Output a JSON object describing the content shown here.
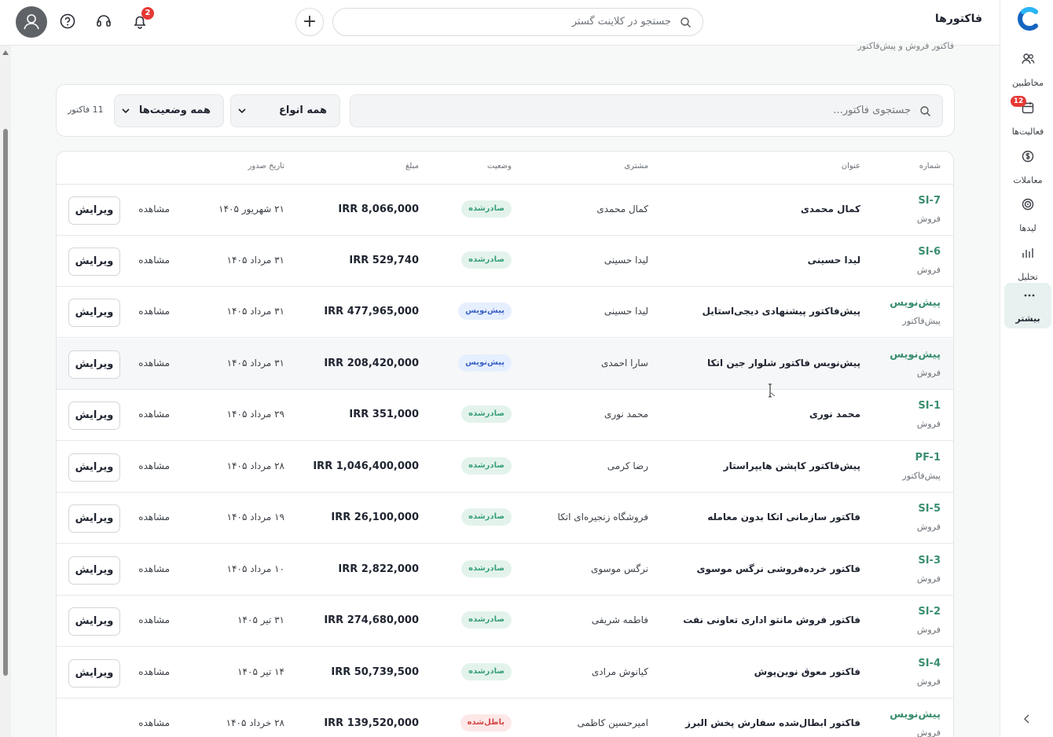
{
  "header": {
    "title": "فاکتورها",
    "search_placeholder": "جستجو در کلاینت گستر",
    "notification_count": "2"
  },
  "breadcrumb": "فاکتور فروش و پیش‌فاکتور",
  "sidebar": {
    "items": [
      {
        "label": "مخاطبین",
        "icon": "contacts-icon"
      },
      {
        "label": "فعالیت‌ها",
        "icon": "calendar-icon",
        "badge": "12"
      },
      {
        "label": "معاملات",
        "icon": "deals-icon"
      },
      {
        "label": "لیدها",
        "icon": "leads-icon"
      },
      {
        "label": "تحلیل",
        "icon": "analytics-icon"
      },
      {
        "label": "بیشتر",
        "icon": "more-icon"
      }
    ]
  },
  "filters": {
    "search_placeholder": "جستجوی فاکتور...",
    "type_select": "همه انواع",
    "status_select": "همه وضعیت‌ها",
    "count_text": "11 فاکتور"
  },
  "table": {
    "headers": {
      "number": "شماره",
      "title": "عنوان",
      "customer": "مشتری",
      "status": "وضعیت",
      "amount": "مبلغ",
      "issue_date": "تاریخ صدور"
    },
    "view_label": "مشاهده",
    "edit_label": "ویرایش",
    "rows": [
      {
        "number": "SI-7",
        "type": "فروش",
        "title": "کمال محمدی",
        "customer": "کمال محمدی",
        "status": "صادرشده",
        "amount": "IRR 8,066,000",
        "date": "۲۱ شهریور ۱۴۰۵"
      },
      {
        "number": "SI-6",
        "type": "فروش",
        "title": "لیدا حسینی",
        "customer": "لیدا حسینی",
        "status": "صادرشده",
        "amount": "IRR 529,740",
        "date": "۳۱ مرداد ۱۴۰۵"
      },
      {
        "number": "پیش‌نویس",
        "type": "پیش‌فاکتور",
        "title": "پیش‌فاکتور پیشنهادی دیجی‌استایل",
        "customer": "لیدا حسینی",
        "status": "پیش‌نویس",
        "amount": "IRR 477,965,000",
        "date": "۳۱ مرداد ۱۴۰۵"
      },
      {
        "number": "پیش‌نویس",
        "type": "فروش",
        "title": "پیش‌نویس فاکتور شلوار جین اتکا",
        "customer": "سارا احمدی",
        "status": "پیش‌نویس",
        "amount": "IRR 208,420,000",
        "date": "۳۱ مرداد ۱۴۰۵"
      },
      {
        "number": "SI-1",
        "type": "فروش",
        "title": "محمد نوری",
        "customer": "محمد نوری",
        "status": "صادرشده",
        "amount": "IRR 351,000",
        "date": "۲۹ مرداد ۱۴۰۵"
      },
      {
        "number": "PF-1",
        "type": "پیش‌فاکتور",
        "title": "پیش‌فاکتور کاپشن هایپراستار",
        "customer": "رضا کرمی",
        "status": "صادرشده",
        "amount": "IRR 1,046,400,000",
        "date": "۲۸ مرداد ۱۴۰۵"
      },
      {
        "number": "SI-5",
        "type": "فروش",
        "title": "فاکتور سازمانی اتکا بدون معامله",
        "customer": "فروشگاه زنجیره‌ای اتکا",
        "status": "صادرشده",
        "amount": "IRR 26,100,000",
        "date": "۱۹ مرداد ۱۴۰۵"
      },
      {
        "number": "SI-3",
        "type": "فروش",
        "title": "فاکتور خرده‌فروشی نرگس موسوی",
        "customer": "نرگس موسوی",
        "status": "صادرشده",
        "amount": "IRR 2,822,000",
        "date": "۱۰ مرداد ۱۴۰۵"
      },
      {
        "number": "SI-2",
        "type": "فروش",
        "title": "فاکتور فروش مانتو اداری تعاونی نفت",
        "customer": "فاطمه شریفی",
        "status": "صادرشده",
        "amount": "IRR 274,680,000",
        "date": "۳۱ تیر ۱۴۰۵"
      },
      {
        "number": "SI-4",
        "type": "فروش",
        "title": "فاکتور معوق نوین‌پوش",
        "customer": "کیانوش مرادی",
        "status": "صادرشده",
        "amount": "IRR 50,739,500",
        "date": "۱۴ تیر ۱۴۰۵"
      },
      {
        "number": "پیش‌نویس",
        "type": "فروش",
        "title": "فاکتور ابطال‌شده سفارش پخش البرز",
        "customer": "امیرحسین کاظمی",
        "status": "باطل‌شده",
        "amount": "IRR 139,520,000",
        "date": "۲۸ خرداد ۱۴۰۵"
      }
    ]
  },
  "colors": {
    "accent": "#3b8f6f",
    "issued_bg": "#e3f3ec",
    "draft_bg": "#e6efff",
    "void_bg": "#fde8e8",
    "logo": "#1565c0"
  }
}
